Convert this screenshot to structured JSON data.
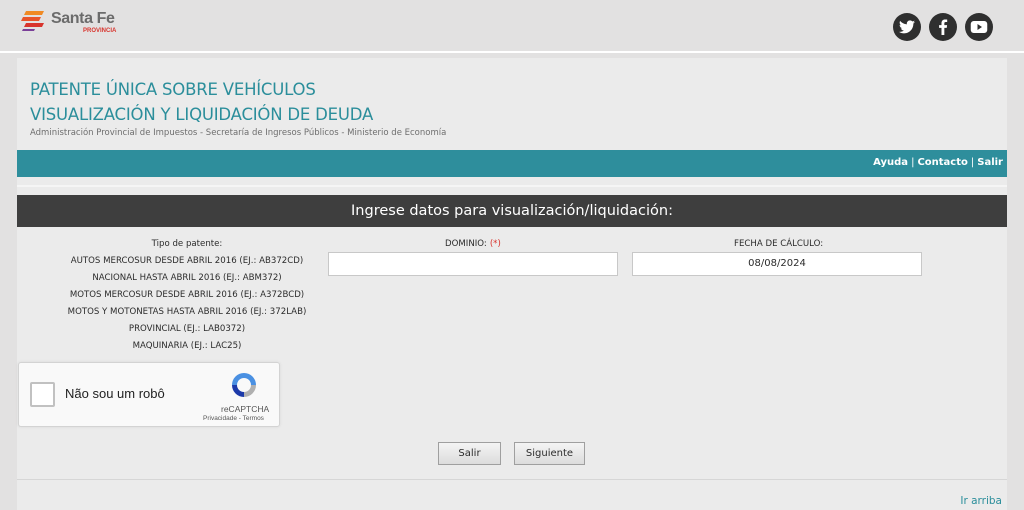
{
  "header": {
    "logo_text": "Santa Fe",
    "logo_subtext": "PROVINCIA",
    "social": [
      "twitter-icon",
      "facebook-icon",
      "youtube-icon"
    ]
  },
  "page": {
    "title_line1": "PATENTE ÚNICA SOBRE VEHÍCULOS",
    "title_line2": "VISUALIZACIÓN Y LIQUIDACIÓN DE DEUDA",
    "subtitle": "Administración Provincial de Impuestos - Secretaría de Ingresos Públicos - Ministerio de Economía"
  },
  "nav": {
    "links": [
      "Ayuda",
      "Contacto",
      "Salir"
    ],
    "separator": "|"
  },
  "form": {
    "heading": "Ingrese datos para visualización/liquidación:",
    "tipo_title": "Tipo de patente:",
    "tipos": [
      "AUTOS MERCOSUR DESDE ABRIL 2016 (EJ.: AB372CD)",
      "NACIONAL HASTA ABRIL 2016 (EJ.: ABM372)",
      "MOTOS MERCOSUR DESDE ABRIL 2016 (EJ.: A372BCD)",
      "MOTOS Y MOTONETAS HASTA ABRIL 2016 (EJ.: 372LAB)",
      "PROVINCIAL (EJ.: LAB0372)",
      "MAQUINARIA (EJ.: LAC25)"
    ],
    "dominio_label": "DOMINIO:",
    "required_mark": "(*)",
    "dominio_value": "",
    "fecha_label": "FECHA DE CÁLCULO:",
    "fecha_value": "08/08/2024",
    "buttons": {
      "salir": "Salir",
      "siguiente": "Siguiente"
    }
  },
  "captcha": {
    "label": "Não sou um robô",
    "brand": "reCAPTCHA",
    "terms": "Privacidade - Termos"
  },
  "footer": {
    "back_to_top": "Ir arriba"
  },
  "colors": {
    "teal": "#2e8e9c",
    "title_teal": "#2b8e9b",
    "dark_header": "#3e3e3e",
    "background": "#e2e1e1",
    "required_red": "#d8342d"
  }
}
